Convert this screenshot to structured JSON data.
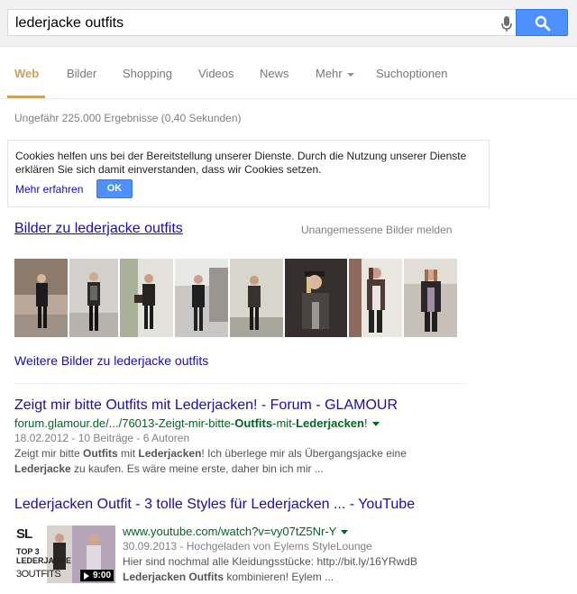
{
  "search": {
    "query": "lederjacke outfits",
    "mic_icon": "microphone-icon",
    "search_icon": "magnifier-icon",
    "button_color": "#4d90fe"
  },
  "tabs": [
    {
      "label": "Web",
      "active": true
    },
    {
      "label": "Bilder"
    },
    {
      "label": "Shopping"
    },
    {
      "label": "Videos"
    },
    {
      "label": "News"
    },
    {
      "label": "Mehr"
    },
    {
      "label": "Suchoptionen"
    }
  ],
  "stats": "Ungefähr 225.000 Ergebnisse (0,40 Sekunden)",
  "cookie": {
    "text": "Cookies helfen uns bei der Bereitstellung unserer Dienste. Durch die Nutzung unserer Dienste erklären Sie sich damit einverstanden, dass wir Cookies setzen.",
    "more_link": "Mehr erfahren",
    "ok_button": "OK"
  },
  "images": {
    "heading": "Bilder zu lederjacke outfits",
    "report": "Unangemessene Bilder melden",
    "more": "Weitere Bilder zu lederjacke outfits"
  },
  "results": [
    {
      "title": "Zeigt mir bitte Outfits mit Lederjacken! - Forum - GLAMOUR",
      "url_prefix": "forum.glamour.de/.../76013-Zeigt-mir-bitte-",
      "url_bold1": "Outfits",
      "url_mid": "-mit-",
      "url_bold2": "Lederjacken",
      "url_suffix": "!",
      "meta": "18.02.2012 - 10 Beiträge - 6 Autoren",
      "snippet_a": "Zeigt mir bitte ",
      "snippet_b1": "Outfits",
      "snippet_c": " mit ",
      "snippet_b2": "Lederjacken",
      "snippet_d": "! Ich überlege mir als Übergangsjacke eine ",
      "snippet_b3": "Lederjacke",
      "snippet_e": " zu kaufen. Es wäre meine erste, daher bin ich mir ..."
    },
    {
      "title": "Lederjacken Outfit - 3 tolle Styles für Lederjacken ... - YouTube",
      "url": "www.youtube.com/watch?v=vy07tZ5Nr-Y",
      "meta": "30.09.2013 - Hochgeladen von Eylems StyleLounge",
      "snippet_a": "Hier sind nochmal alle Kleidungsstücke: http://bit.ly/16YRwdB",
      "snippet_b1": "Lederjacken Outfits",
      "snippet_c": " kombinieren! Eylem ...",
      "video_duration": "9:00",
      "video_overlay_top": "SL",
      "video_overlay_mid": "TOP 3 ",
      "video_overlay_bold": "LEDERJACKE",
      "video_overlay_bottom": "3OUTFITS"
    }
  ]
}
